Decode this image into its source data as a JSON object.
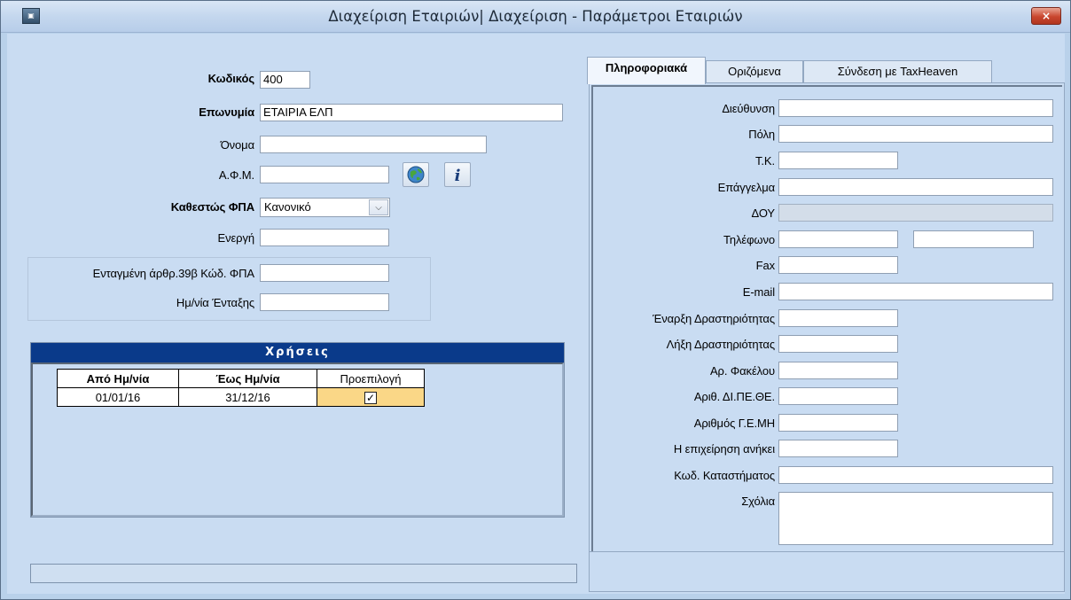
{
  "window": {
    "title": "Διαχείριση Εταιριών| Διαχείριση - Παράμετροι Εταιριών",
    "close_label": "×"
  },
  "left": {
    "code_label": "Κωδικός",
    "code_value": "400",
    "name_label": "Επωνυμία",
    "name_value": "ΕΤΑΙΡΙΑ ΕΛΠ",
    "first_name_label": "Όνομα",
    "first_name_value": "",
    "afm_label": "Α.Φ.Μ.",
    "afm_value": "",
    "vat_status_label": "Καθεστώς ΦΠΑ",
    "vat_status_value": "Κανονικό",
    "active_label": "Ενεργή",
    "active_value": "",
    "art39b_label": "Ενταγμένη άρθρ.39β Κώδ. ΦΠΑ",
    "art39b_value": "",
    "join_date_label": "Ημ/νία Ένταξης",
    "join_date_value": ""
  },
  "uses": {
    "title": "Χρήσεις",
    "columns": [
      "Από Ημ/νία",
      "Έως Ημ/νία",
      "Προεπιλογή"
    ],
    "rows": [
      {
        "from": "01/01/16",
        "to": "31/12/16",
        "default_checked": true
      }
    ]
  },
  "tabs": [
    {
      "label": "Πληροφοριακά",
      "active": true
    },
    {
      "label": "Οριζόμενα",
      "active": false
    },
    {
      "label": "Σύνδεση με TaxHeaven",
      "active": false
    }
  ],
  "info": {
    "address_label": "Διεύθυνση",
    "city_label": "Πόλη",
    "zip_label": "Τ.Κ.",
    "profession_label": "Επάγγελμα",
    "doy_label": "ΔΟΥ",
    "phone_label": "Τηλέφωνο",
    "fax_label": "Fax",
    "email_label": "E-mail",
    "start_label": "Έναρξη Δραστηριότητας",
    "end_label": "Λήξη Δραστηριότητας",
    "folder_label": "Αρ. Φακέλου",
    "dipethe_label": "Αριθ. ΔΙ.ΠΕ.ΘΕ.",
    "gemi_label": "Αριθμός Γ.Ε.ΜΗ",
    "belongs_label": "Η επιχείρηση ανήκει",
    "store_code_label": "Κωδ. Καταστήματος",
    "comments_label": "Σχόλια"
  },
  "icons": {
    "globe": "globe-icon",
    "info": "info-icon"
  },
  "colors": {
    "window_bg": "#c9dcf2",
    "header_blue": "#0a3a8a",
    "highlight_cell": "#fad787"
  }
}
